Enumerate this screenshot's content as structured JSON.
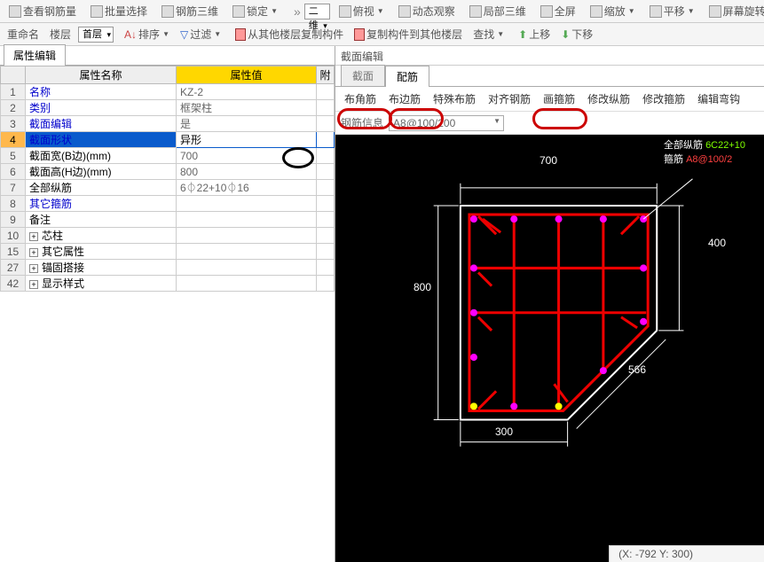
{
  "toolbar_top": {
    "view_rebar": "查看钢筋量",
    "batch_select": "批量选择",
    "rebar_3d": "钢筋三维",
    "lock": "锁定",
    "view2d": "二维",
    "top_view": "俯视",
    "dynamic_view": "动态观察",
    "local_3d": "局部三维",
    "fullscreen": "全屏",
    "zoom": "缩放",
    "pan": "平移",
    "screen_rotate": "屏幕旋转"
  },
  "toolbar_mid": {
    "rename": "重命名",
    "floor": "楼层",
    "floor_select": "首层",
    "sort": "排序",
    "filter": "过滤",
    "copy_from": "从其他楼层复制构件",
    "copy_to": "复制构件到其他楼层",
    "find": "查找",
    "up": "上移",
    "down": "下移"
  },
  "left_tab": "属性编辑",
  "prop_header": {
    "name": "属性名称",
    "val": "属性值",
    "ext": "附"
  },
  "props": [
    {
      "idx": "1",
      "name": "名称",
      "val": "KZ-2",
      "blue": true
    },
    {
      "idx": "2",
      "name": "类别",
      "val": "框架柱",
      "blue": true
    },
    {
      "idx": "3",
      "name": "截面编辑",
      "val": "是",
      "blue": true
    },
    {
      "idx": "4",
      "name": "截面形状",
      "val": "异形",
      "blue": true,
      "selected": true
    },
    {
      "idx": "5",
      "name": "截面宽(B边)(mm)",
      "val": "700"
    },
    {
      "idx": "6",
      "name": "截面高(H边)(mm)",
      "val": "800"
    },
    {
      "idx": "7",
      "name": "全部纵筋",
      "val": "6⏀22+10⏀16"
    },
    {
      "idx": "8",
      "name": "其它箍筋",
      "val": "",
      "blue": true
    },
    {
      "idx": "9",
      "name": "备注",
      "val": ""
    },
    {
      "idx": "10",
      "name": "芯柱",
      "val": "",
      "expand": true
    },
    {
      "idx": "15",
      "name": "其它属性",
      "val": "",
      "expand": true
    },
    {
      "idx": "27",
      "name": "锚固搭接",
      "val": "",
      "expand": true
    },
    {
      "idx": "42",
      "name": "显示样式",
      "val": "",
      "expand": true
    }
  ],
  "right": {
    "header": "截面编辑",
    "tabs": [
      "截面",
      "配筋"
    ],
    "active_tab": 1,
    "toolbar": [
      "布角筋",
      "布边筋",
      "特殊布筋",
      "对齐钢筋",
      "画箍筋",
      "修改纵筋",
      "修改箍筋",
      "编辑弯钩"
    ],
    "info_label": "钢筋信息",
    "info_value": "A8@100/200"
  },
  "dims": {
    "top": "700",
    "right": "400",
    "left": "800",
    "diag": "566",
    "bottom": "300"
  },
  "legend": {
    "line1": "全部纵筋",
    "line2": "箍筋",
    "val1": "6C22+10",
    "val2": "A8@100/2"
  },
  "status": "(X: -792 Y: 300)"
}
